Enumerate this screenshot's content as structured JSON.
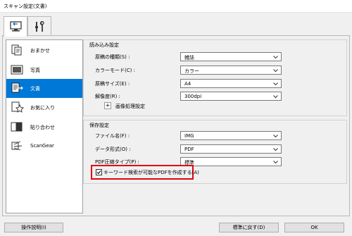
{
  "window": {
    "title": "スキャン設定(文書)"
  },
  "tabs": [
    {
      "name": "scan-from-computer",
      "icon": "computer-arrow-icon"
    },
    {
      "name": "general-settings",
      "icon": "tools-icon"
    }
  ],
  "nav": {
    "items": [
      {
        "label": "おまかせ",
        "icon": "auto-document-icon",
        "selected": false
      },
      {
        "label": "写真",
        "icon": "photo-icon",
        "selected": false
      },
      {
        "label": "文書",
        "icon": "document-icon",
        "selected": true
      },
      {
        "label": "お気に入り",
        "icon": "favorite-icon",
        "selected": false
      },
      {
        "label": "貼り合わせ",
        "icon": "stitch-icon",
        "selected": false
      },
      {
        "label": "ScanGear",
        "icon": "scangear-icon",
        "selected": false
      }
    ]
  },
  "scan_settings": {
    "title": "読み込み設定",
    "rows": [
      {
        "label": "原稿の種類(S) :",
        "value": "雑誌"
      },
      {
        "label": "カラーモード(C) :",
        "value": "カラー"
      },
      {
        "label": "原稿サイズ(E) :",
        "value": "A4"
      },
      {
        "label": "解像度(R) :",
        "value": "300dpi"
      }
    ],
    "image_processing": {
      "symbol": "+",
      "label": "画像処理設定"
    }
  },
  "save_settings": {
    "title": "保存設定",
    "rows": [
      {
        "label": "ファイル名(F) :",
        "value": "IMG"
      },
      {
        "label": "データ形式(O) :",
        "value": "PDF"
      },
      {
        "label": "PDF圧縮タイプ(P) :",
        "value": "標準"
      }
    ],
    "keyword_pdf": {
      "label": "キーワード検索が可能なPDFを作成する(A)",
      "checked": true
    }
  },
  "footer": {
    "instructions": "操作説明(I)",
    "defaults": "標準に戻す(D)",
    "ok": "OK"
  },
  "colors": {
    "selected": "#0078d7",
    "highlight": "#e20012"
  }
}
